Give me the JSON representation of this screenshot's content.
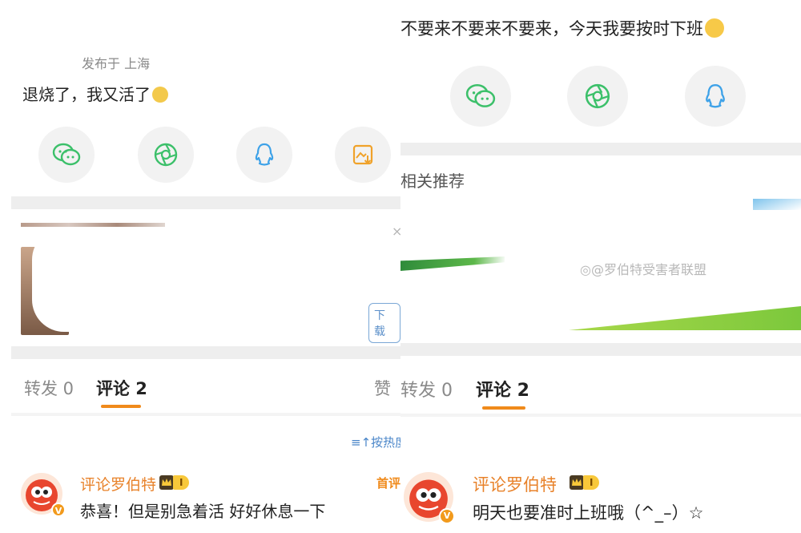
{
  "left": {
    "location": "发布于 上海",
    "post_text": "退烧了，我又活了",
    "tabs": {
      "repost": "转发 0",
      "comments": "评论 2",
      "likes": "赞"
    },
    "sort": "按热度",
    "ad": {
      "download": "下载"
    },
    "comment": {
      "name": "评论罗伯特",
      "level": "I",
      "text": "恭喜！但是别急着活 好好休息一下",
      "pin": "首评"
    }
  },
  "right": {
    "post_text": "不要来不要来不要来，今天我要按时下班",
    "recommend_label": "相关推荐",
    "watermark": "@罗伯特受害者联盟",
    "tabs": {
      "repost": "转发 0",
      "comments": "评论 2"
    },
    "comment": {
      "name": "评论罗伯特",
      "level": "I",
      "text": "明天也要准时上班哦（^_–）☆"
    }
  },
  "share_icons": [
    "wechat-icon",
    "moments-icon",
    "qq-icon",
    "save-image-icon"
  ],
  "colors": {
    "accent_orange": "#f08a1b",
    "wechat_green": "#3cc06a",
    "qq_blue": "#3ea2e8",
    "link_blue": "#4a86c9"
  }
}
